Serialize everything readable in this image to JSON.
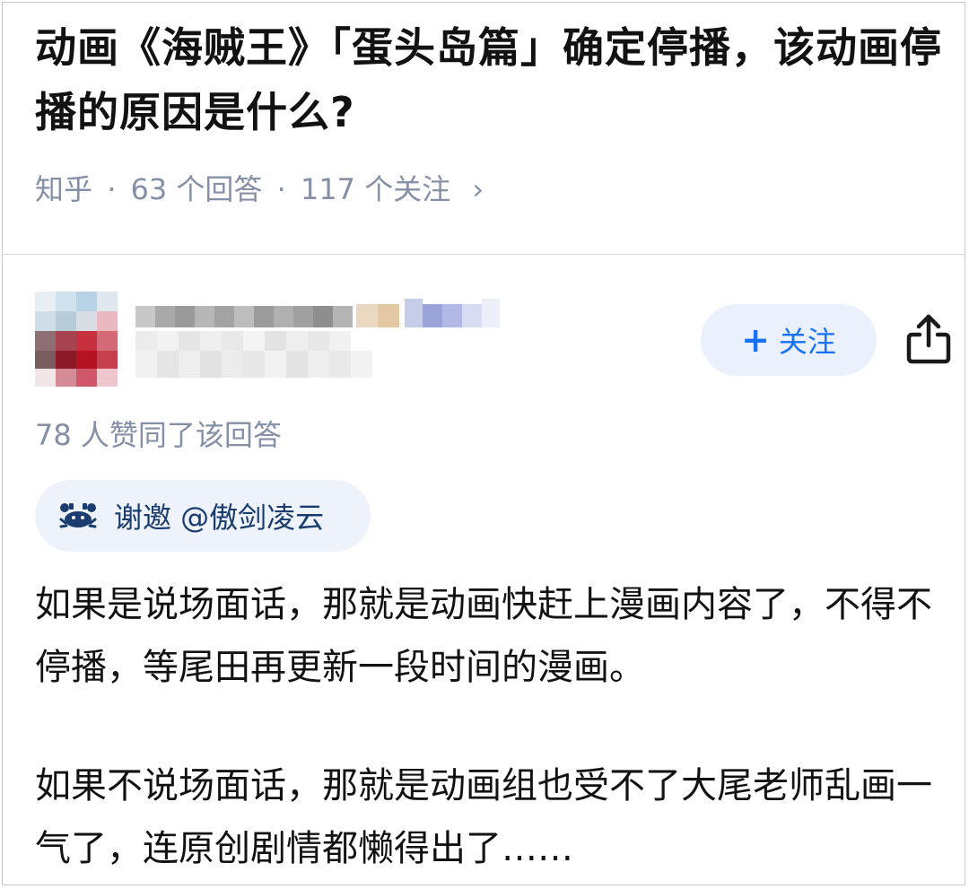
{
  "question": {
    "title": "动画《海贼王》「蛋头岛篇」确定停播，该动画停播的原因是什么?",
    "meta": {
      "source": "知乎",
      "separator": "·",
      "answers": "63 个回答",
      "followers": "117 个关注",
      "chevron": "›"
    }
  },
  "author": {
    "follow_button": {
      "plus": "+",
      "label": "关注"
    },
    "share_icon": "share-icon"
  },
  "answer": {
    "vote_text": "78 人赞同了该回答",
    "invite_text": "谢邀 @傲剑凌云",
    "paragraphs": [
      "如果是说场面话，那就是动画快赶上漫画内容了，不得不停播，等尾田再更新一段时间的漫画。",
      "如果不说场面话，那就是动画组也受不了大尾老师乱画一气了，连原创剧情都懒得出了……"
    ]
  },
  "colors": {
    "accent": "#1772f6",
    "meta_gray": "#8590a6",
    "text": "#121212",
    "follow_bg": "#eaf1fc",
    "invite_bg": "#eef3fb"
  }
}
